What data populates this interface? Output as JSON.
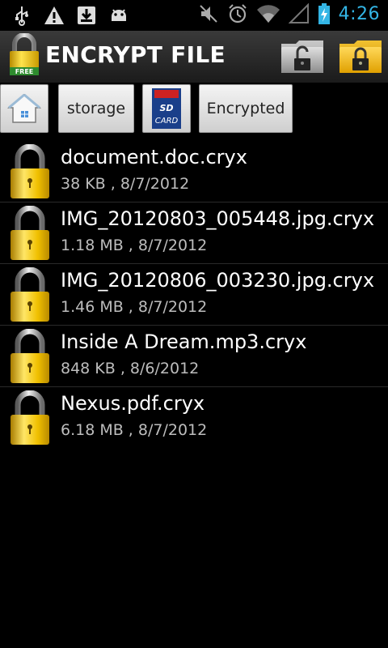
{
  "status_bar": {
    "icons": [
      "usb-icon",
      "warning-icon",
      "download-icon",
      "android-debug-icon"
    ],
    "right_icons": [
      "mute-icon",
      "alarm-icon",
      "wifi-icon",
      "signal-icon",
      "battery-charging-icon"
    ],
    "time": "4:26",
    "accent_color": "#33b5e5"
  },
  "title_bar": {
    "title": "ENCRYPT FILE",
    "app_badge": "FREE",
    "buttons": [
      "decrypt-folder-button",
      "encrypt-folder-button"
    ]
  },
  "path_bar": {
    "items": [
      {
        "label": "",
        "icon": "home-icon"
      },
      {
        "label": "storage"
      },
      {
        "label": "",
        "icon": "sd-card-icon",
        "icon_text_top": "SD",
        "icon_text_bottom": "CARD"
      },
      {
        "label": "Encrypted"
      }
    ]
  },
  "files": [
    {
      "name": "document.doc.cryx",
      "meta": "38 KB , 8/7/2012"
    },
    {
      "name": "IMG_20120803_005448.jpg.cryx",
      "meta": "1.18 MB , 8/7/2012"
    },
    {
      "name": "IMG_20120806_003230.jpg.cryx",
      "meta": "1.46 MB , 8/7/2012"
    },
    {
      "name": "Inside A Dream.mp3.cryx",
      "meta": "848 KB , 8/6/2012"
    },
    {
      "name": "Nexus.pdf.cryx",
      "meta": "6.18 MB , 8/7/2012"
    }
  ]
}
